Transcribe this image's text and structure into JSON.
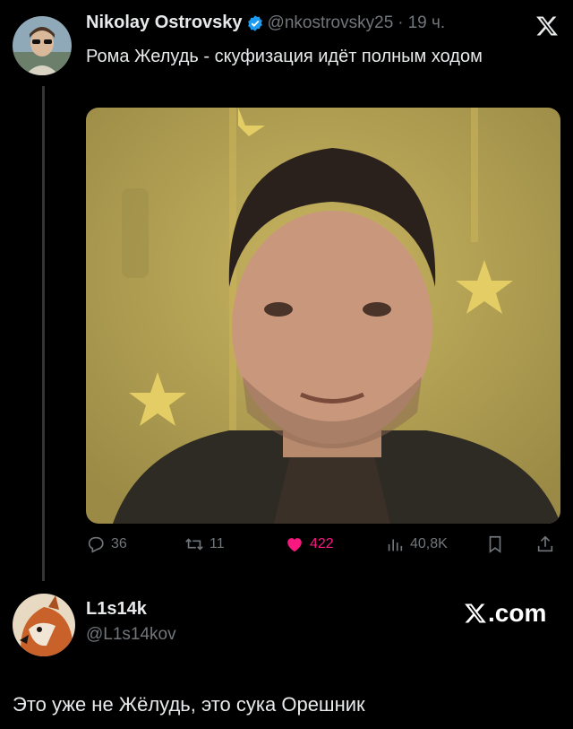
{
  "tweet": {
    "author_name": "Nikolay Ostrovsky",
    "handle": "@nkostrovsky25",
    "separator": "·",
    "time": "19 ч.",
    "text": "Рома Желудь - скуфизация идёт полным ходом",
    "media": {
      "description": "photo",
      "bg_color": "#b9a558"
    },
    "actions": {
      "replies": "36",
      "reposts": "11",
      "likes": "422",
      "views": "40,8K"
    },
    "colors": {
      "verified": "#1d9bf0",
      "like": "#f91880",
      "muted": "#71767b"
    }
  },
  "reply": {
    "author_name": "L1s14k",
    "handle": "@L1s14kov",
    "site_tag": ".com",
    "text": "Это уже не Жёлудь, это сука Орешник"
  }
}
